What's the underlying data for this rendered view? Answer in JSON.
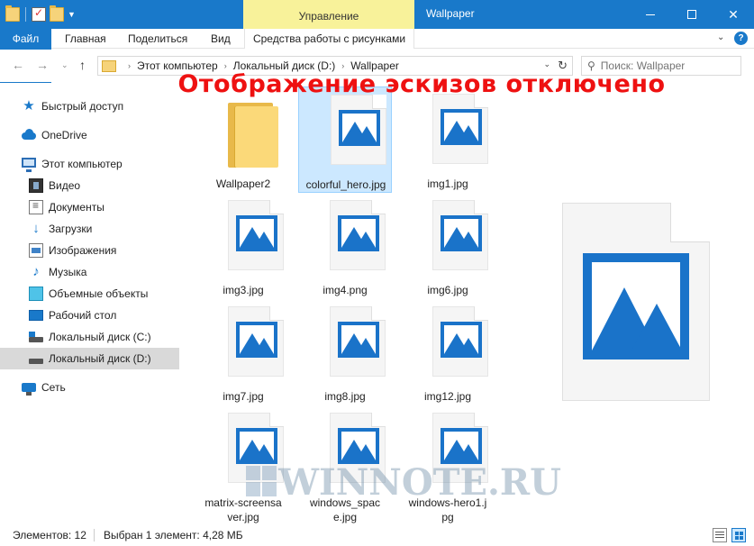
{
  "window": {
    "title": "Wallpaper",
    "manage_tab": "Управление"
  },
  "ribbon": {
    "file": "Файл",
    "home": "Главная",
    "share": "Поделиться",
    "view": "Вид",
    "picture_tools": "Средства работы с рисунками"
  },
  "address": {
    "crumbs": [
      "Этот компьютер",
      "Локальный диск (D:)",
      "Wallpaper"
    ]
  },
  "search": {
    "placeholder": "Поиск: Wallpaper"
  },
  "sidebar": {
    "items": [
      {
        "label": "Быстрый доступ",
        "icon": "star-icon"
      },
      {
        "label": "OneDrive",
        "icon": "cloud-icon"
      },
      {
        "label": "Этот компьютер",
        "icon": "computer-icon"
      },
      {
        "label": "Видео",
        "icon": "video-icon"
      },
      {
        "label": "Документы",
        "icon": "documents-icon"
      },
      {
        "label": "Загрузки",
        "icon": "download-icon"
      },
      {
        "label": "Изображения",
        "icon": "pictures-icon"
      },
      {
        "label": "Музыка",
        "icon": "music-icon"
      },
      {
        "label": "Объемные объекты",
        "icon": "3d-objects-icon"
      },
      {
        "label": "Рабочий стол",
        "icon": "desktop-icon"
      },
      {
        "label": "Локальный диск (C:)",
        "icon": "drive-icon"
      },
      {
        "label": "Локальный диск (D:)",
        "icon": "drive-icon"
      },
      {
        "label": "Сеть",
        "icon": "network-icon"
      }
    ],
    "selected": "Локальный диск (D:)"
  },
  "overlay": {
    "heading": "Отображение эскизов отключено"
  },
  "files": [
    {
      "name": "Wallpaper2",
      "type": "folder"
    },
    {
      "name": "colorful_hero.jpg",
      "type": "image",
      "selected": true
    },
    {
      "name": "img1.jpg",
      "type": "image"
    },
    {
      "name": "img3.jpg",
      "type": "image"
    },
    {
      "name": "img4.png",
      "type": "image"
    },
    {
      "name": "img6.jpg",
      "type": "image"
    },
    {
      "name": "img7.jpg",
      "type": "image"
    },
    {
      "name": "img8.jpg",
      "type": "image"
    },
    {
      "name": "img12.jpg",
      "type": "image"
    },
    {
      "name": "matrix-screensaver.jpg",
      "type": "image"
    },
    {
      "name": "windows_space.jpg",
      "type": "image"
    },
    {
      "name": "windows-hero1.jpg",
      "type": "image"
    }
  ],
  "watermark": {
    "text": "WINNOTE.RU"
  },
  "status": {
    "count": "Элементов: 12",
    "selection": "Выбран 1 элемент: 4,28 МБ"
  },
  "colors": {
    "accent": "#1979ca",
    "manage_tab": "#f8f29a",
    "overlay_text": "#ee1111",
    "selection": "#cce8ff"
  }
}
